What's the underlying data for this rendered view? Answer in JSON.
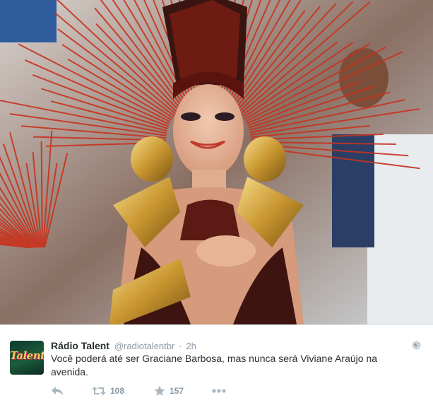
{
  "photo": {
    "subject_icon": "carnival-dancer-photo"
  },
  "tweet": {
    "avatar_label": "Talent",
    "author_name": "Rádio Talent",
    "handle": "@radiotalentbr",
    "separator": "·",
    "time": "2h",
    "text": "Você poderá até ser Graciane Barbosa, mas nunca será Viviane Araújo na avenida.",
    "retweet_count": "108",
    "favorite_count": "157"
  },
  "colors": {
    "meta_gray": "#8899a6",
    "text_dark": "#292f33",
    "feather_red": "#c8321e",
    "gold": "#d9a63a"
  },
  "icons": {
    "reply": "reply-icon",
    "retweet": "retweet-icon",
    "favorite": "star-icon",
    "more": "more-icon",
    "globe": "globe-icon"
  }
}
